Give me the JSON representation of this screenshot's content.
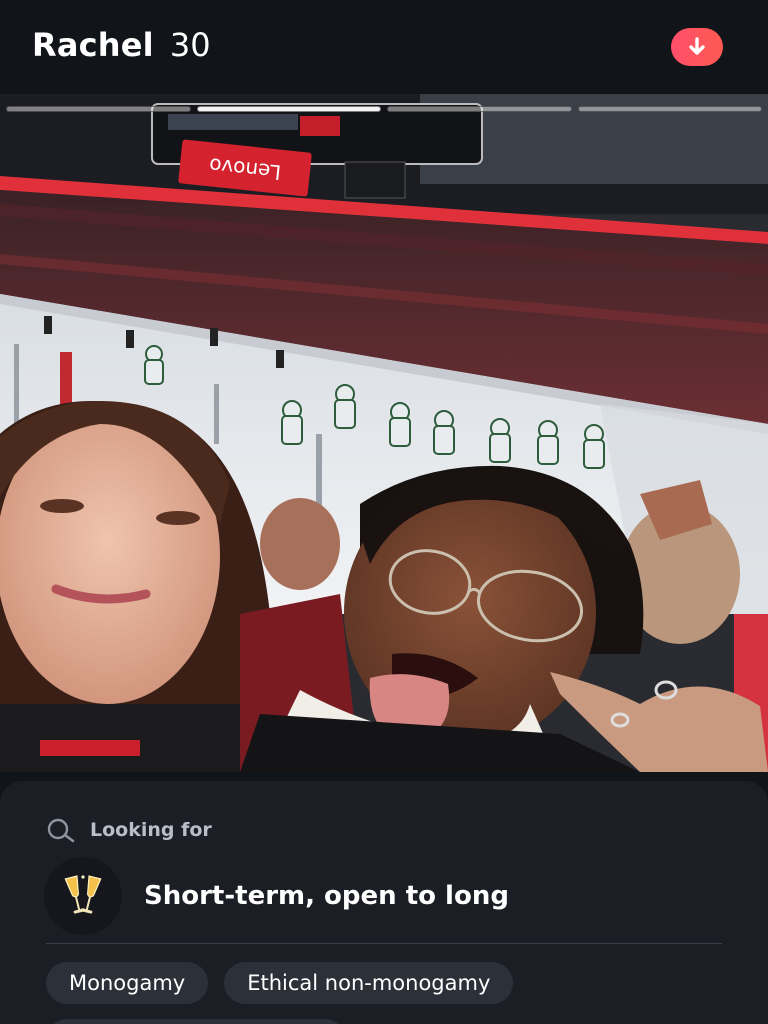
{
  "profile": {
    "name": "Rachel",
    "age": "30"
  },
  "icons": {
    "collapse": "arrow-down-icon",
    "search": "magnifier-icon",
    "goal": "champagne-glasses-icon"
  },
  "photo": {
    "count": 4,
    "active_index": 2,
    "scoreboard_sponsor": "Lenovo"
  },
  "looking_for": {
    "label": "Looking for",
    "value": "Short-term, open to long"
  },
  "tags": [
    "Monogamy",
    "Ethical non-monogamy"
  ],
  "colors": {
    "accent": "#fe4f68",
    "background": "#111418",
    "card": "#1b1e24",
    "chip": "#2c3039"
  }
}
